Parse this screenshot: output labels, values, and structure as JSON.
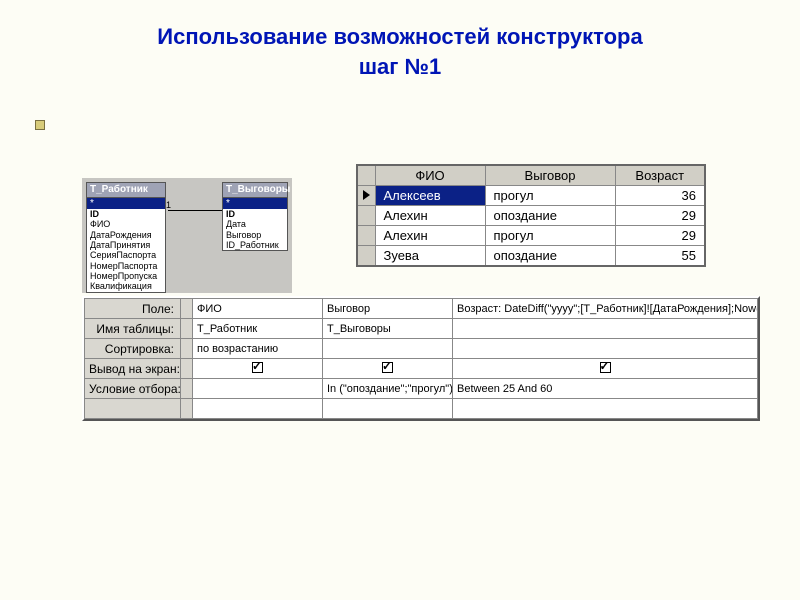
{
  "slide": {
    "title_line1": "Использование возможностей конструктора",
    "title_line2": "шаг №1"
  },
  "tables": {
    "t1": {
      "title": "Т_Работник",
      "star": "*",
      "fields": [
        "ID",
        "ФИО",
        "ДатаРождения",
        "ДатаПринятия",
        "СерияПаспорта",
        "НомерПаспорта",
        "НомерПропуска",
        "Квалификация"
      ]
    },
    "t2": {
      "title": "Т_Выговоры",
      "star": "*",
      "fields": [
        "ID",
        "Дата",
        "Выговор",
        "ID_Работник"
      ]
    }
  },
  "datasheet": {
    "headers": [
      "ФИО",
      "Выговор",
      "Возраст"
    ],
    "rows": [
      {
        "fio": "Алексеев",
        "vyg": "прогул",
        "age": "36",
        "selected": true
      },
      {
        "fio": "Алехин",
        "vyg": "опоздание",
        "age": "29"
      },
      {
        "fio": "Алехин",
        "vyg": "прогул",
        "age": "29"
      },
      {
        "fio": "Зуева",
        "vyg": "опоздание",
        "age": "55"
      }
    ]
  },
  "design": {
    "labels": {
      "field": "Поле:",
      "table": "Имя таблицы:",
      "sort": "Сортировка:",
      "show": "Вывод на экран:",
      "criteria": "Условие отбора:",
      "or": ""
    },
    "cols": [
      {
        "field": "ФИО",
        "table": "Т_Работник",
        "sort": "по возрастанию",
        "show": true,
        "criteria": ""
      },
      {
        "field": "Выговор",
        "table": "Т_Выговоры",
        "sort": "",
        "show": true,
        "criteria": "In (\"опоздание\";\"прогул\")"
      },
      {
        "field": "Возраст: DateDiff(\"yyyy\";[Т_Работник]![ДатаРождения];Now())",
        "table": "",
        "sort": "",
        "show": true,
        "criteria": "Between 25 And 60"
      }
    ]
  }
}
